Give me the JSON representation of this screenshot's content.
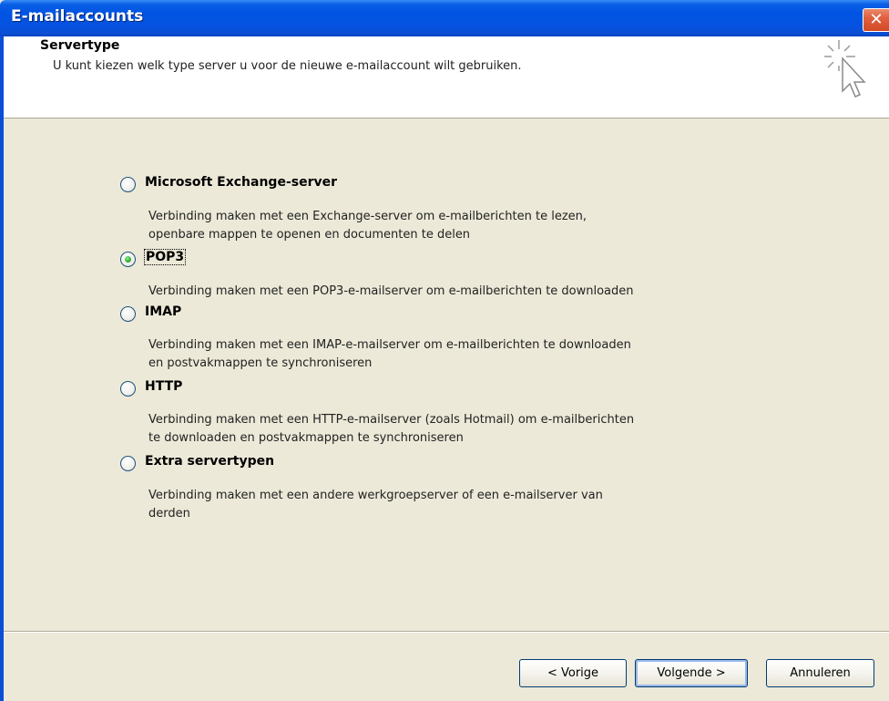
{
  "window": {
    "title": "E-mailaccounts"
  },
  "header": {
    "title": "Servertype",
    "subtitle": "U kunt kiezen welk type server u voor de nieuwe e-mailaccount wilt gebruiken."
  },
  "options": [
    {
      "label": "Microsoft Exchange-server",
      "desc1": "Verbinding maken met een Exchange-server om e-mailberichten te lezen,",
      "desc2": "openbare mappen te openen en documenten te delen",
      "checked": false
    },
    {
      "label": "POP3",
      "desc1": "Verbinding maken met een POP3-e-mailserver om e-mailberichten te downloaden",
      "desc2": "",
      "checked": true
    },
    {
      "label": "IMAP",
      "desc1": "Verbinding maken met een IMAP-e-mailserver om e-mailberichten te downloaden",
      "desc2": "en postvakmappen te synchroniseren",
      "checked": false
    },
    {
      "label": "HTTP",
      "desc1": "Verbinding maken met een HTTP-e-mailserver (zoals Hotmail) om e-mailberichten",
      "desc2": "te downloaden en postvakmappen te synchroniseren",
      "checked": false
    },
    {
      "label": "Extra servertypen",
      "desc1": "Verbinding maken met een andere werkgroepserver of een e-mailserver van",
      "desc2": "derden",
      "checked": false
    }
  ],
  "buttons": {
    "prev": "< Vorige",
    "next": "Volgende >",
    "cancel": "Annuleren"
  },
  "icons": {
    "close": "close-icon",
    "wizard": "cursor-sparkle-icon"
  }
}
